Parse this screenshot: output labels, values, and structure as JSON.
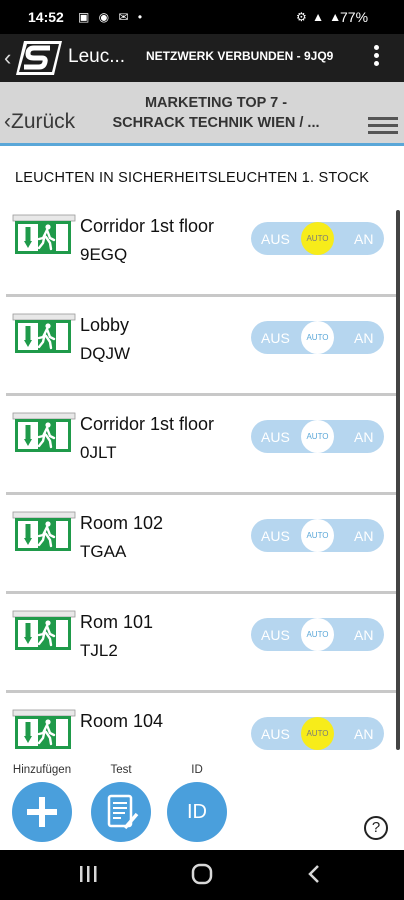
{
  "status_bar": {
    "time": "14:52",
    "battery": "77%"
  },
  "app_bar": {
    "app_name": "Leuc...",
    "connection_status": "NETZWERK VERBUNDEN - 9JQ9"
  },
  "nav": {
    "back_label": "Zurück",
    "title_line1": "MARKETING TOP 7 -",
    "title_line2": "SCHRACK TECHNIK WIEN / ..."
  },
  "section_title": "LEUCHTEN IN SICHERHEITSLEUCHTEN 1. STOCK",
  "toggle_labels": {
    "off": "AUS",
    "auto": "AUTO",
    "on": "AN"
  },
  "lights": [
    {
      "name": "Corridor 1st floor",
      "id": "9EGQ",
      "mode": "AUTO",
      "auto_highlighted": true
    },
    {
      "name": "Lobby",
      "id": "DQJW",
      "mode": "AUTO",
      "auto_highlighted": false
    },
    {
      "name": "Corridor 1st floor",
      "id": "0JLT",
      "mode": "AUTO",
      "auto_highlighted": false
    },
    {
      "name": "Room 102",
      "id": "TGAA",
      "mode": "AUTO",
      "auto_highlighted": false
    },
    {
      "name": "Rom 101",
      "id": "TJL2",
      "mode": "AUTO",
      "auto_highlighted": false
    },
    {
      "name": "Room 104",
      "id": "",
      "mode": "AUTO",
      "auto_highlighted": true
    }
  ],
  "actions": {
    "add_label": "Hinzufügen",
    "test_label": "Test",
    "id_label": "ID",
    "id_button_text": "ID",
    "help_symbol": "?"
  },
  "colors": {
    "accent": "#4a9fdc",
    "toggle_track": "#b6d6ef",
    "auto_highlight": "#f7ec1a",
    "exit_green": "#1f9a4a"
  }
}
